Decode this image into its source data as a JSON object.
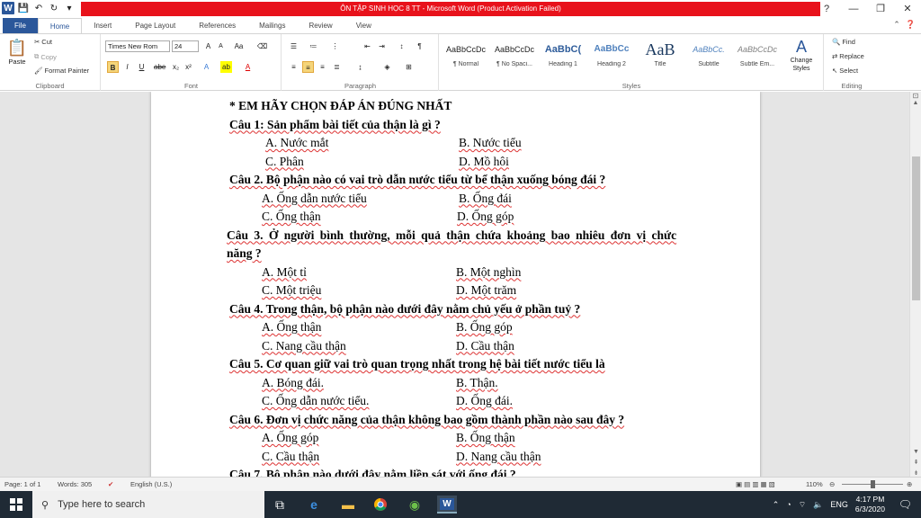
{
  "window": {
    "title": "ÔN TẬP SINH HỌC 8 TT  -  Microsoft Word (Product Activation Failed)",
    "controls": [
      "?",
      "—",
      "❐",
      "✕"
    ]
  },
  "tabs": [
    "File",
    "Home",
    "Insert",
    "Page Layout",
    "References",
    "Mailings",
    "Review",
    "View"
  ],
  "active_tab": "Home",
  "ribbon": {
    "clipboard": {
      "paste": "Paste",
      "cut": "Cut",
      "copy": "Copy",
      "format_painter": "Format Painter",
      "label": "Clipboard"
    },
    "font": {
      "name": "Times New Rom",
      "size": "24",
      "label": "Font",
      "bold": "B",
      "italic": "I",
      "underline": "U",
      "strike": "abe",
      "sub": "x₂",
      "sup": "x²"
    },
    "paragraph": {
      "label": "Paragraph"
    },
    "styles": {
      "label": "Styles",
      "items": [
        {
          "preview": "AaBbCcDc",
          "name": "¶ Normal"
        },
        {
          "preview": "AaBbCcDc",
          "name": "¶ No Spaci..."
        },
        {
          "preview": "AaBbC(",
          "name": "Heading 1"
        },
        {
          "preview": "AaBbCc",
          "name": "Heading 2"
        },
        {
          "preview": "AaB",
          "name": "Title"
        },
        {
          "preview": "AaBbCc.",
          "name": "Subtitle"
        },
        {
          "preview": "AaBbCcDc",
          "name": "Subtle Em..."
        }
      ],
      "change_styles": "Change Styles"
    },
    "editing": {
      "find": "Find",
      "replace": "Replace",
      "select": "Select",
      "label": "Editing"
    }
  },
  "document": {
    "heading": "* EM HÃY CHỌN ĐÁP ÁN ĐÚNG NHẤT",
    "questions": [
      {
        "q": "Câu 1: Sản phẩm bài tiết của thận là gì ?",
        "a": "A. Nước mắt",
        "b": "B. Nước tiểu",
        "c": "C. Phân",
        "d": "D. Mồ hôi"
      },
      {
        "q": "Câu 2. Bộ phận nào có vai trò dẫn nước tiểu từ bể thận xuống bóng đái ?",
        "a": "A. Ống dẫn nước tiểu",
        "b": "B. Ống đái",
        "c": "C. Ống thận",
        "d": "D. Ống góp"
      },
      {
        "q": "Câu 3. Ở người bình thường, mỗi quả thận chứa khoảng bao nhiêu đơn vị chức",
        "q2": "năng ?",
        "a": "A. Một tỉ",
        "b": "B. Một nghìn",
        "c": "C. Một triệu",
        "d": "D. Một trăm"
      },
      {
        "q": "Câu 4. Trong thận, bộ phận nào dưới đây nằm chủ yếu ở phần tuỷ ?",
        "a": "A. Ống thận",
        "b": "B. Ống góp",
        "c": "C. Nang cầu thận",
        "d": "D. Cầu thận"
      },
      {
        "q": "Câu 5. Cơ quan giữ vai trò quan trọng nhất trong hệ bài tiết nước tiểu là",
        "a": "A. Bóng đái.",
        "b": "B. Thận.",
        "c": "C. Ống dẫn nước tiểu.",
        "d": "D. Ống đái."
      },
      {
        "q": "Câu 6. Đơn vị chức năng của thận không bao gồm thành phần nào sau đây ?",
        "a": "A. Ống góp",
        "b": "B. Ống thận",
        "c": "C. Cầu thận",
        "d": "D. Nang cầu thận"
      }
    ],
    "partial_line": "Câu 7. Bộ phận nào dưới đây nằm liền sát với ống đái ?"
  },
  "status": {
    "page": "Page: 1 of 1",
    "words": "Words: 305",
    "language": "English (U.S.)",
    "zoom": "110%"
  },
  "taskbar": {
    "search_placeholder": "Type here to search",
    "lang": "ENG",
    "time": "4:17 PM",
    "date": "6/3/2020"
  }
}
